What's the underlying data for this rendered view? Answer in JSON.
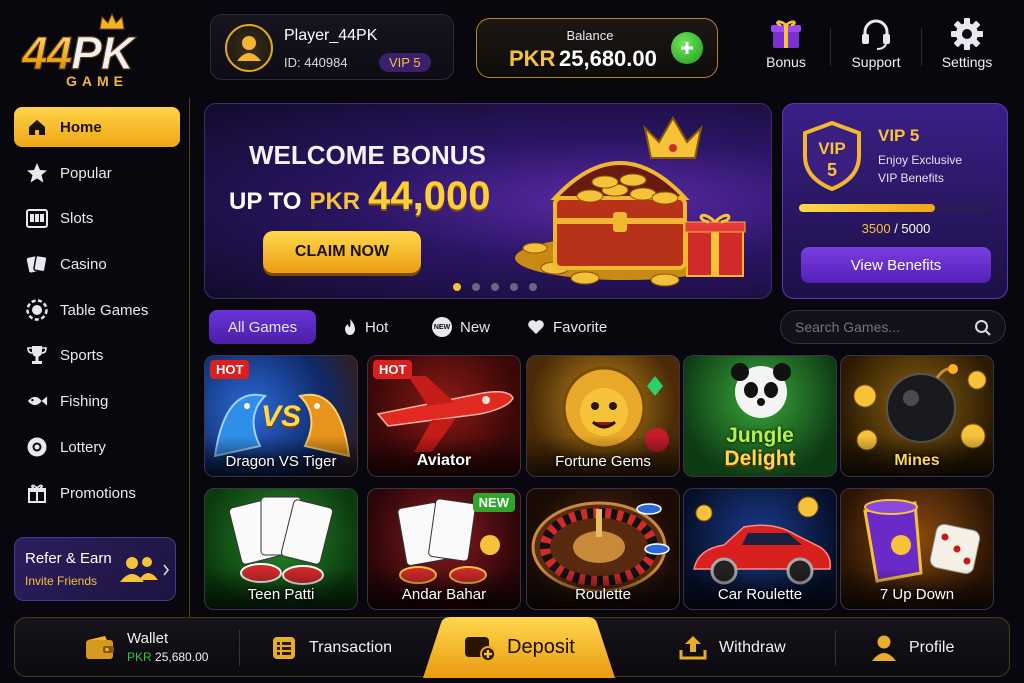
{
  "brand": {
    "logo_main": "44",
    "logo_accent": "PK",
    "logo_sub": "GAME"
  },
  "player": {
    "name": "Player_44PK",
    "id": "ID: 440984",
    "vip_badge": "VIP 5",
    "avatar_icon": "user-avatar-icon"
  },
  "balance": {
    "label": "Balance",
    "currency": "PKR",
    "amount": "25,680.00",
    "add_icon": "plus-icon"
  },
  "top_actions": [
    {
      "label": "Bonus",
      "icon": "gift-icon"
    },
    {
      "label": "Support",
      "icon": "headset-icon"
    },
    {
      "label": "Settings",
      "icon": "gear-icon"
    }
  ],
  "sidebar": {
    "items": [
      {
        "label": "Home",
        "icon": "home-icon",
        "active": true
      },
      {
        "label": "Popular",
        "icon": "star-icon"
      },
      {
        "label": "Slots",
        "icon": "slot-machine-icon"
      },
      {
        "label": "Casino",
        "icon": "cards-icon"
      },
      {
        "label": "Table Games",
        "icon": "chip-icon"
      },
      {
        "label": "Sports",
        "icon": "trophy-icon"
      },
      {
        "label": "Fishing",
        "icon": "fish-icon"
      },
      {
        "label": "Lottery",
        "icon": "lottery-ball-icon"
      },
      {
        "label": "Promotions",
        "icon": "gift-icon"
      }
    ],
    "refer": {
      "title": "Refer & Earn",
      "subtitle": "Invite Friends",
      "icon": "users-icon"
    }
  },
  "banner": {
    "line1": "WELCOME BONUS",
    "line2_prefix": "UP TO",
    "line2_currency": "PKR",
    "line2_amount": "44,000",
    "cta": "CLAIM NOW",
    "slides": 5,
    "active_slide": 1
  },
  "vip_card": {
    "shield_top": "VIP",
    "shield_num": "5",
    "title": "VIP 5",
    "desc1": "Enjoy Exclusive",
    "desc2": "VIP Benefits",
    "progress_current": "3500",
    "progress_separator": " / ",
    "progress_total": "5000",
    "progress_fraction": 0.7,
    "button": "View Benefits"
  },
  "filters": {
    "tabs": [
      {
        "label": "All Games",
        "icon": "",
        "active": true
      },
      {
        "label": "Hot",
        "icon": "flame-icon"
      },
      {
        "label": "New",
        "icon": "new-tag-icon"
      },
      {
        "label": "Favorite",
        "icon": "heart-icon"
      }
    ],
    "new_tag_text": "NEW",
    "search_placeholder": "Search Games...",
    "search_icon": "search-icon"
  },
  "games": [
    {
      "name": "Dragon VS Tiger",
      "badge": "HOT",
      "vs_text": "VS"
    },
    {
      "name": "Aviator",
      "badge": "HOT"
    },
    {
      "name": "Fortune Gems"
    },
    {
      "name": "Jungle Delight",
      "title_line1": "Jungle",
      "title_line2": "Delight"
    },
    {
      "name": "Mines"
    },
    {
      "name": "Teen Patti"
    },
    {
      "name": "Andar Bahar",
      "badge": "NEW"
    },
    {
      "name": "Roulette"
    },
    {
      "name": "Car Roulette"
    },
    {
      "name": "7 Up Down"
    }
  ],
  "bottom_bar": {
    "wallet": {
      "label": "Wallet",
      "currency": "PKR",
      "amount": "25,680.00",
      "icon": "wallet-icon"
    },
    "transaction": {
      "label": "Transaction",
      "icon": "list-icon"
    },
    "deposit": {
      "label": "Deposit",
      "icon": "deposit-icon"
    },
    "withdraw": {
      "label": "Withdraw",
      "icon": "upload-tray-icon"
    },
    "profile": {
      "label": "Profile",
      "icon": "person-icon"
    }
  },
  "colors": {
    "accent_gold": "#f6c23a",
    "vip_purple": "#4a23a8",
    "add_green": "#35c23a",
    "hot_red": "#d8211f",
    "new_green": "#2fa52a"
  }
}
